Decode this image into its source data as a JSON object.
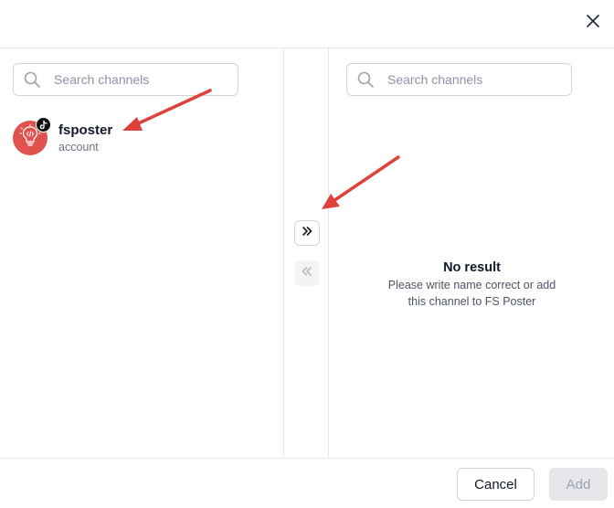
{
  "modal": {
    "close_icon": "close-icon"
  },
  "left_panel": {
    "search": {
      "placeholder": "Search channels",
      "value": ""
    },
    "channels": [
      {
        "name": "fsposter",
        "subtitle": "account",
        "avatar_icon": "lightbulb-code-icon",
        "badge_icon": "tiktok-icon",
        "avatar_color": "#e0524e"
      }
    ]
  },
  "right_panel": {
    "search": {
      "placeholder": "Search channels",
      "value": ""
    },
    "empty_title": "No result",
    "empty_description": "Please write name correct or add this channel to FS Poster"
  },
  "transfer": {
    "move_right_icon": "chevrons-right-icon",
    "move_left_icon": "chevrons-left-icon"
  },
  "footer": {
    "cancel_label": "Cancel",
    "add_label": "Add"
  },
  "colors": {
    "annotation_arrow": "#e0403a",
    "disabled_button": "#e5e7eb"
  }
}
